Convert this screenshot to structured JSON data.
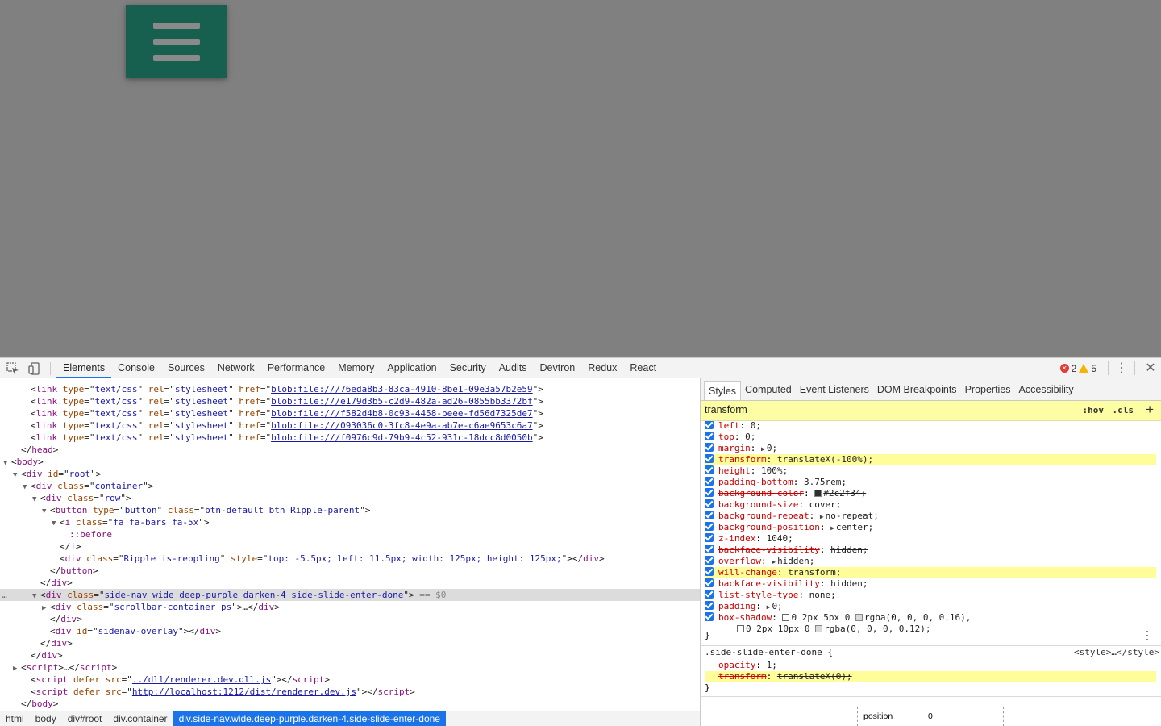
{
  "devtools": {
    "tabs": [
      "Elements",
      "Console",
      "Sources",
      "Network",
      "Performance",
      "Memory",
      "Application",
      "Security",
      "Audits",
      "Devtron",
      "Redux",
      "React"
    ],
    "active_tab": "Elements",
    "error_count": "2",
    "warning_count": "5"
  },
  "elements": {
    "lines": [
      {
        "indent": 3,
        "html": "&lt;<span class=t>link</span> <span class=an>type</span>=\"<span class=av>text/css</span>\" <span class=an>rel</span>=\"<span class=av>stylesheet</span>\" <span class=an>href</span>=\"<span class=link>blob:file:///76eda8b3-83ca-4910-8be1-09e3a57b2e59</span>\"&gt;"
      },
      {
        "indent": 3,
        "html": "&lt;<span class=t>link</span> <span class=an>type</span>=\"<span class=av>text/css</span>\" <span class=an>rel</span>=\"<span class=av>stylesheet</span>\" <span class=an>href</span>=\"<span class=link>blob:file:///e179d3b5-c2d9-482a-ad26-0855bb3372bf</span>\"&gt;"
      },
      {
        "indent": 3,
        "html": "&lt;<span class=t>link</span> <span class=an>type</span>=\"<span class=av>text/css</span>\" <span class=an>rel</span>=\"<span class=av>stylesheet</span>\" <span class=an>href</span>=\"<span class=link>blob:file:///f582d4b8-0c93-4458-beee-fd56d7325de7</span>\"&gt;"
      },
      {
        "indent": 3,
        "html": "&lt;<span class=t>link</span> <span class=an>type</span>=\"<span class=av>text/css</span>\" <span class=an>rel</span>=\"<span class=av>stylesheet</span>\" <span class=an>href</span>=\"<span class=link>blob:file:///093036c0-3fc8-4e9a-ab7e-c6ae9653c6a7</span>\"&gt;"
      },
      {
        "indent": 3,
        "html": "&lt;<span class=t>link</span> <span class=an>type</span>=\"<span class=av>text/css</span>\" <span class=an>rel</span>=\"<span class=av>stylesheet</span>\" <span class=an>href</span>=\"<span class=link>blob:file:///f0976c9d-79b9-4c52-931c-18dcc8d0050b</span>\"&gt;"
      },
      {
        "indent": 2,
        "html": "&lt;/<span class=t>head</span>&gt;"
      },
      {
        "indent": 1,
        "tri": "open",
        "html": "&lt;<span class=t>body</span>&gt;"
      },
      {
        "indent": 2,
        "tri": "open",
        "html": "&lt;<span class=t>div</span> <span class=an>id</span>=\"<span class=av>root</span>\"&gt;"
      },
      {
        "indent": 3,
        "tri": "open",
        "html": "&lt;<span class=t>div</span> <span class=an>class</span>=\"<span class=av>container</span>\"&gt;"
      },
      {
        "indent": 4,
        "tri": "open",
        "html": "&lt;<span class=t>div</span> <span class=an>class</span>=\"<span class=av>row</span>\"&gt;"
      },
      {
        "indent": 5,
        "tri": "open",
        "html": "&lt;<span class=t>button</span> <span class=an>type</span>=\"<span class=av>button</span>\" <span class=an>class</span>=\"<span class=av>btn-default btn Ripple-parent</span>\"&gt;"
      },
      {
        "indent": 6,
        "tri": "open",
        "html": "&lt;<span class=t>i</span> <span class=an>class</span>=\"<span class=av>fa fa-bars fa-5x</span>\"&gt;"
      },
      {
        "indent": 7,
        "html": "<span class=pseudo>::before</span>"
      },
      {
        "indent": 6,
        "html": "&lt;/<span class=t>i</span>&gt;"
      },
      {
        "indent": 6,
        "html": "&lt;<span class=t>div</span> <span class=an>class</span>=\"<span class=av>Ripple is-reppling</span>\" <span class=an>style</span>=\"<span class=av>top: -5.5px; left: 11.5px; width: 125px; height: 125px;</span>\"&gt;&lt;/<span class=t>div</span>&gt;"
      },
      {
        "indent": 5,
        "html": "&lt;/<span class=t>button</span>&gt;"
      },
      {
        "indent": 4,
        "html": "&lt;/<span class=t>div</span>&gt;"
      },
      {
        "indent": 4,
        "tri": "open",
        "selected": true,
        "html": "&lt;<span class=t>div</span> <span class=an>class</span>=\"<span class=av>side-nav wide deep-purple darken-4 side-slide-enter-done</span>\"&gt; <span class=dim>== $0</span>"
      },
      {
        "indent": 5,
        "tri": "closed",
        "html": "&lt;<span class=t>div</span> <span class=an>class</span>=\"<span class=av>scrollbar-container ps</span>\"&gt;…&lt;/<span class=t>div</span>&gt;"
      },
      {
        "indent": 5,
        "html": "&lt;/<span class=t>div</span>&gt;"
      },
      {
        "indent": 5,
        "html": "&lt;<span class=t>div</span> <span class=an>id</span>=\"<span class=av>sidenav-overlay</span>\"&gt;&lt;/<span class=t>div</span>&gt;"
      },
      {
        "indent": 4,
        "html": "&lt;/<span class=t>div</span>&gt;"
      },
      {
        "indent": 3,
        "html": "&lt;/<span class=t>div</span>&gt;"
      },
      {
        "indent": 2,
        "tri": "closed",
        "html": "&lt;<span class=t>script</span>&gt;…&lt;/<span class=t>script</span>&gt;"
      },
      {
        "indent": 3,
        "html": "&lt;<span class=t>script</span> <span class=an>defer</span> <span class=an>src</span>=\"<span class=link>../dll/renderer.dev.dll.js</span>\"&gt;&lt;/<span class=t>script</span>&gt;"
      },
      {
        "indent": 3,
        "html": "&lt;<span class=t>script</span> <span class=an>defer</span> <span class=an>src</span>=\"<span class=link>http://localhost:1212/dist/renderer.dev.js</span>\"&gt;&lt;/<span class=t>script</span>&gt;"
      },
      {
        "indent": 2,
        "html": "&lt;/<span class=t>body</span>&gt;"
      }
    ]
  },
  "breadcrumbs": [
    "html",
    "body",
    "div#root",
    "div.container",
    "div.side-nav.wide.deep-purple.darken-4.side-slide-enter-done"
  ],
  "styles": {
    "tabs": [
      "Styles",
      "Computed",
      "Event Listeners",
      "DOM Breakpoints",
      "Properties",
      "Accessibility"
    ],
    "filter_value": "transform",
    "hov_label": ":hov",
    "cls_label": ".cls",
    "props": [
      {
        "name": "left",
        "value": "0;"
      },
      {
        "name": "top",
        "value": "0;"
      },
      {
        "name": "margin",
        "value": "0;",
        "tri": true
      },
      {
        "name": "transform",
        "value": "translateX(-100%);",
        "hl": true
      },
      {
        "name": "height",
        "value": "100%;"
      },
      {
        "name": "padding-bottom",
        "value": "3.75rem;"
      },
      {
        "name": "background-color",
        "value": "#2c2f34;",
        "strike": true,
        "swatch": "#2c2f34"
      },
      {
        "name": "background-size",
        "value": "cover;"
      },
      {
        "name": "background-repeat",
        "value": "no-repeat;",
        "tri": true
      },
      {
        "name": "background-position",
        "value": "center;",
        "tri": true
      },
      {
        "name": "z-index",
        "value": "1040;"
      },
      {
        "name": "backface-visibility",
        "value": "hidden;",
        "strike": true
      },
      {
        "name": "overflow",
        "value": "hidden;",
        "tri": true
      },
      {
        "name": "will-change",
        "value": "transform;",
        "hl": true
      },
      {
        "name": "backface-visibility",
        "value": "hidden;"
      },
      {
        "name": "list-style-type",
        "value": "none;"
      },
      {
        "name": "padding",
        "value": "0;",
        "tri": true
      },
      {
        "name": "box-shadow",
        "value": "0 2px 5px 0 rgba(0, 0, 0, 0.16),",
        "shadow": true
      },
      {
        "name": "",
        "value": "0 2px 10px 0 rgba(0, 0, 0, 0.12);",
        "continuation": true,
        "shadow": true
      }
    ],
    "rule2_selector": ".side-slide-enter-done {",
    "rule2_source": "<style>…</style>",
    "rule2_props": [
      {
        "name": "opacity",
        "value": "1;"
      },
      {
        "name": "transform",
        "value": "translateX(0);",
        "strike": true,
        "hl": true
      }
    ],
    "boxmodel_label": "position",
    "boxmodel_value": "0"
  }
}
